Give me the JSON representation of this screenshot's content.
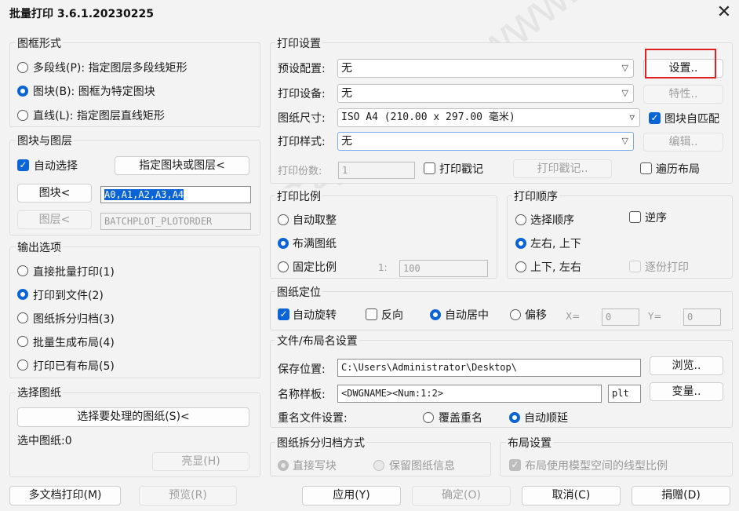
{
  "window": {
    "title": "批量打印 3.6.1.20230225",
    "close": "✕"
  },
  "frame_form": {
    "title": "图框形式",
    "options": [
      {
        "label": "多段线(P): 指定图层多段线矩形",
        "checked": false
      },
      {
        "label": "图块(B): 图框为特定图块",
        "checked": true
      },
      {
        "label": "直线(L): 指定图层直线矩形",
        "checked": false
      }
    ]
  },
  "block_layer": {
    "title": "图块与图层",
    "auto_select": "自动选择",
    "specify_button": "指定图块或图层<",
    "block_button": "图块<",
    "block_value": "A0,A1,A2,A3,A4",
    "layer_button": "图层<",
    "layer_value": "BATCHPLOT_PLOTORDER"
  },
  "output": {
    "title": "输出选项",
    "options": [
      {
        "label": "直接批量打印(1)",
        "checked": false
      },
      {
        "label": "打印到文件(2)",
        "checked": true
      },
      {
        "label": "图纸拆分归档(3)",
        "checked": false
      },
      {
        "label": "批量生成布局(4)",
        "checked": false
      },
      {
        "label": "打印已有布局(5)",
        "checked": false
      }
    ]
  },
  "select_sheets": {
    "title": "选择图纸",
    "select_button": "选择要处理的图纸(S)<",
    "selected_label": "选中图纸:0",
    "highlight_button": "亮显(H)"
  },
  "print_settings": {
    "title": "打印设置",
    "preset_label": "预设配置:",
    "preset_value": "无",
    "settings_button": "设置..",
    "device_label": "打印设备:",
    "device_value": "无",
    "props_button": "特性..",
    "paper_label": "图纸尺寸:",
    "paper_value": "ISO A4 (210.00 x 297.00 毫米)",
    "auto_match": "图块自匹配",
    "style_label": "打印样式:",
    "style_value": "无",
    "edit_button": "编辑..",
    "copies_label": "打印份数:",
    "copies_value": "1",
    "stamp_check": "打印戳记",
    "stamp_button": "打印戳记..",
    "traverse_layout": "遍历布局"
  },
  "scale": {
    "title": "打印比例",
    "options": [
      {
        "label": "自动取整",
        "checked": false
      },
      {
        "label": "布满图纸",
        "checked": true
      },
      {
        "label": "固定比例",
        "checked": false
      }
    ],
    "ratio_prefix": "1:",
    "ratio_value": "100"
  },
  "order": {
    "title": "打印顺序",
    "options": [
      {
        "label": "选择顺序",
        "checked": false
      },
      {
        "label": "左右, 上下",
        "checked": true
      },
      {
        "label": "上下, 左右",
        "checked": false
      }
    ],
    "reverse": "逆序",
    "copy_print": "逐份打印"
  },
  "positioning": {
    "title": "图纸定位",
    "auto_rotate": "自动旋转",
    "reverse": "反向",
    "auto_center": "自动居中",
    "offset": "偏移",
    "x_label": "X=",
    "x_value": "0",
    "y_label": "Y=",
    "y_value": "0"
  },
  "file_name": {
    "title": "文件/布局名设置",
    "save_label": "保存位置:",
    "save_value": "C:\\Users\\Administrator\\Desktop\\",
    "browse_button": "浏览..",
    "template_label": "名称样板:",
    "template_value": "<DWGNAME><Num:1:2>",
    "ext_value": "plt",
    "variable_button": "变量..",
    "rename_label": "重名文件设置:",
    "overwrite": "覆盖重名",
    "auto_increment": "自动顺延"
  },
  "archive": {
    "title": "图纸拆分归档方式",
    "direct_write": "直接写块",
    "keep_info": "保留图纸信息"
  },
  "layout": {
    "title": "布局设置",
    "use_model_ltscale": "布局使用模型空间的线型比例"
  },
  "footer": {
    "multi_doc": "多文档打印(M)",
    "preview": "预览(R)",
    "apply": "应用(Y)",
    "ok": "确定(O)",
    "cancel": "取消(C)",
    "donate": "捐赠(D)"
  },
  "colors": {
    "accent": "#0a64d6",
    "highlight_box": "#e02020"
  }
}
